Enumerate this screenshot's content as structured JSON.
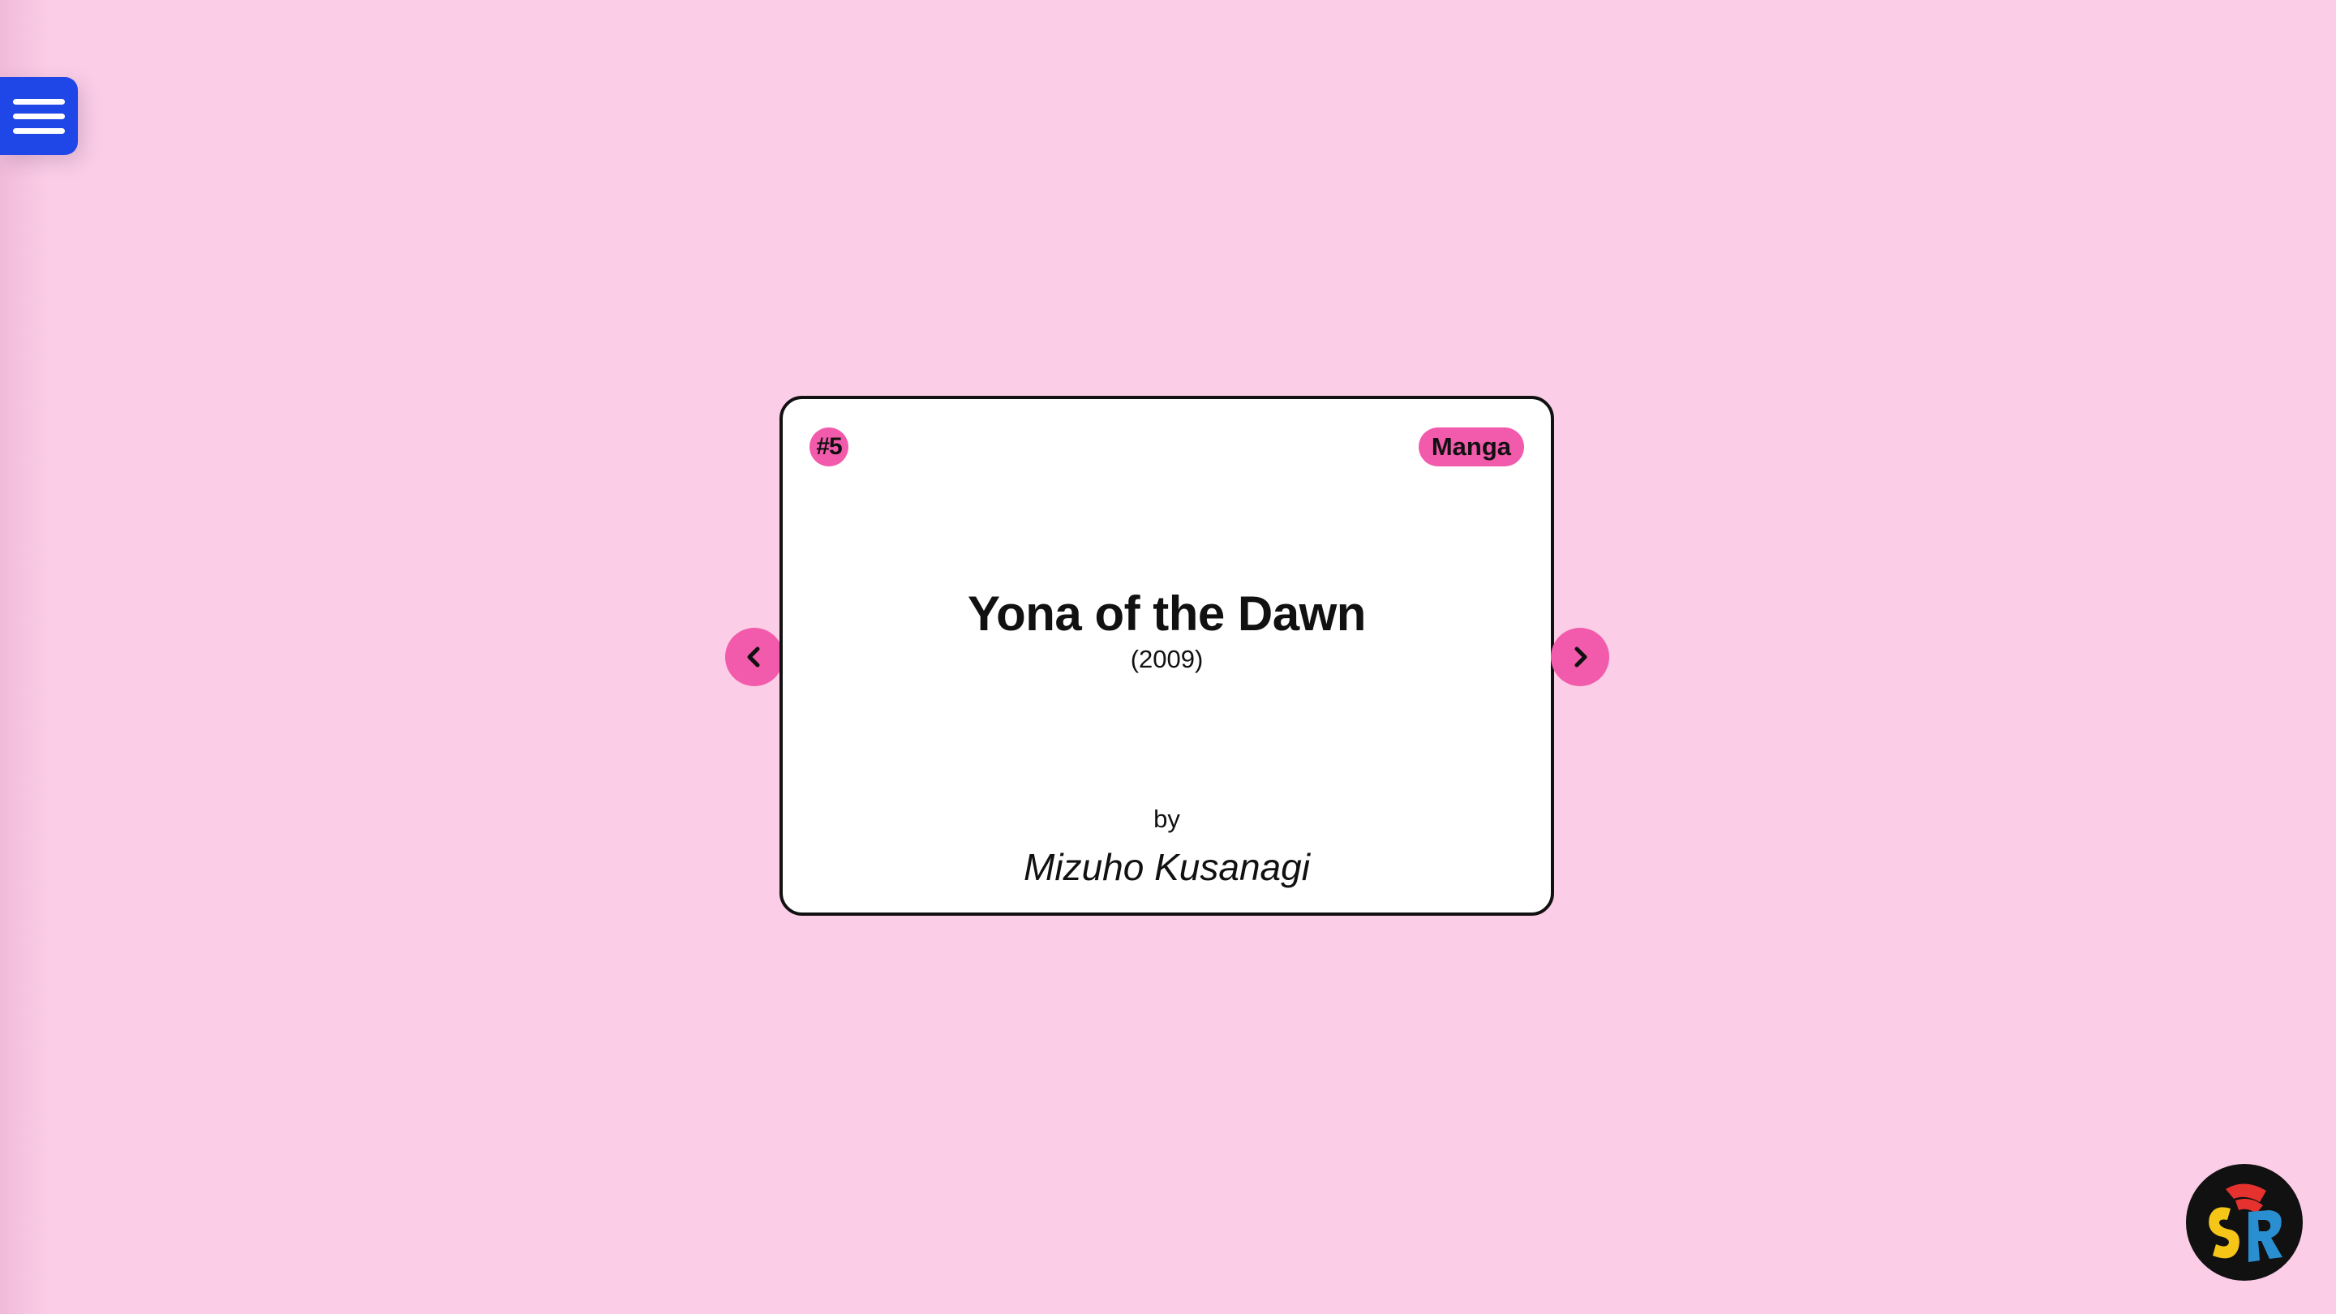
{
  "menu": {
    "icon": "hamburger-menu-icon"
  },
  "card": {
    "number": "#5",
    "type": "Manga",
    "title": "Yona of the Dawn",
    "year": "(2009)",
    "by_label": "by",
    "author": "Mizuho Kusanagi"
  },
  "navigation": {
    "prev_icon": "chevron-left-icon",
    "next_icon": "chevron-right-icon"
  },
  "logo": {
    "letters": "SR",
    "icon": "sr-logo-icon"
  },
  "colors": {
    "background": "#fbcde7",
    "accent": "#f25aab",
    "menu_button": "#1f46e6",
    "card": "#ffffff",
    "border": "#111111"
  }
}
